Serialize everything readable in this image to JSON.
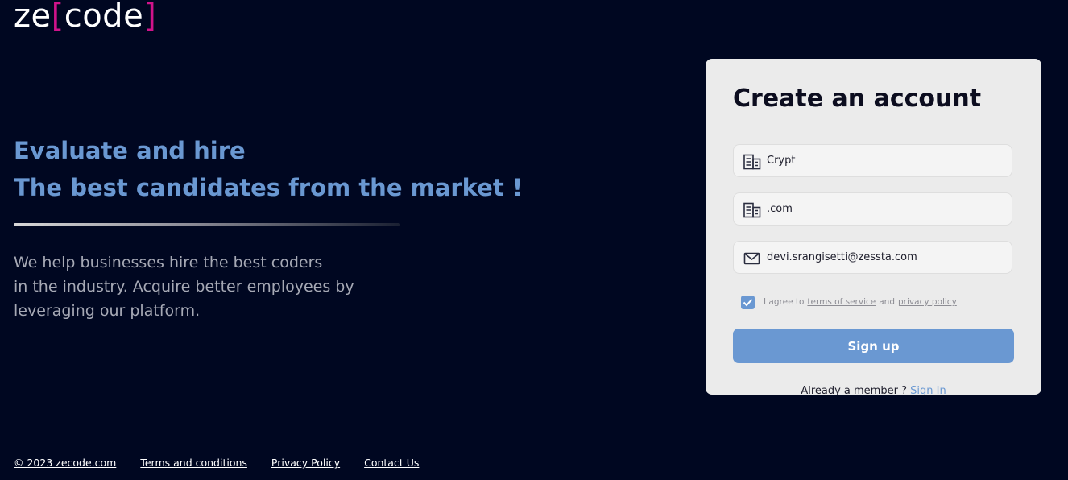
{
  "logo": {
    "prefix": "ze",
    "open_bracket": "[",
    "word": "code",
    "close_bracket": "]",
    "bracket_color": "#d0138b"
  },
  "hero": {
    "title_line1": "Evaluate and hire",
    "title_line2": "The best candidates from the market !",
    "description_lines": [
      "We help businesses hire the best coders",
      "in the industry. Acquire better employees by",
      "leveraging our platform."
    ],
    "accent_color": "#6a98d2"
  },
  "signup_form": {
    "title": "Create an account",
    "fields": [
      {
        "icon": "building-icon",
        "value": "Crypt"
      },
      {
        "icon": "building-icon",
        "value": ".com"
      },
      {
        "icon": "mail-icon",
        "value": "devi.srangisetti@zessta.com"
      }
    ],
    "agree": {
      "checked": true,
      "prefix": "I agree to",
      "terms_link": "terms of service",
      "and": "and",
      "privacy_link": "privacy policy"
    },
    "signup_label": "Sign up",
    "member_text": "Already a member ?",
    "signin_label": "Sign In",
    "button_color": "#6a98d2"
  },
  "footer": {
    "copyright": "© 2023 zecode.com",
    "links": [
      "Terms and conditions",
      "Privacy Policy",
      "Contact Us"
    ]
  },
  "colors": {
    "background": "#000721",
    "card": "#ebebeb"
  }
}
